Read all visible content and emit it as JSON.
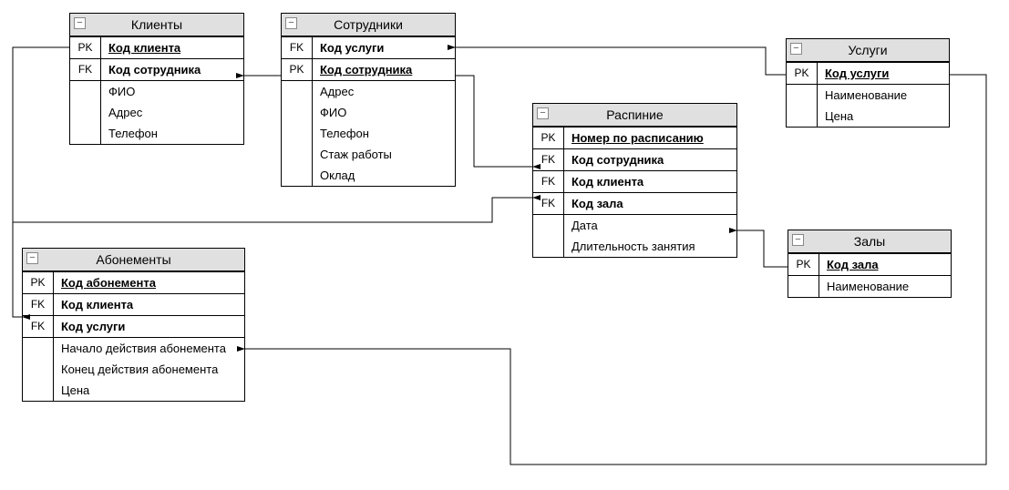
{
  "entities": {
    "clients": {
      "title": "Клиенты",
      "rows": [
        {
          "key": "PK",
          "label": "Код клиента",
          "cls": "pk"
        },
        {
          "key": "FK",
          "label": "Код сотрудника",
          "cls": "fk"
        },
        {
          "key": "",
          "label": "ФИО"
        },
        {
          "key": "",
          "label": "Адрес"
        },
        {
          "key": "",
          "label": "Телефон"
        }
      ]
    },
    "employees": {
      "title": "Сотрудники",
      "rows": [
        {
          "key": "FK",
          "label": "Код услуги",
          "cls": "fk"
        },
        {
          "key": "PK",
          "label": "Код сотрудника",
          "cls": "pk"
        },
        {
          "key": "",
          "label": "Адрес"
        },
        {
          "key": "",
          "label": "ФИО"
        },
        {
          "key": "",
          "label": "Телефон"
        },
        {
          "key": "",
          "label": "Стаж работы"
        },
        {
          "key": "",
          "label": "Оклад"
        }
      ]
    },
    "schedule": {
      "title": "Распиние",
      "rows": [
        {
          "key": "PK",
          "label": "Номер по расписанию",
          "cls": "pk"
        },
        {
          "key": "FK",
          "label": "Код сотрудника",
          "cls": "fk"
        },
        {
          "key": "FK",
          "label": "Код клиента",
          "cls": "fk"
        },
        {
          "key": "FK",
          "label": "Код зала",
          "cls": "fk"
        },
        {
          "key": "",
          "label": "Дата"
        },
        {
          "key": "",
          "label": "Длительность занятия"
        }
      ]
    },
    "services": {
      "title": "Услуги",
      "rows": [
        {
          "key": "PK",
          "label": "Код услуги",
          "cls": "pk"
        },
        {
          "key": "",
          "label": "Наименование"
        },
        {
          "key": "",
          "label": "Цена"
        }
      ]
    },
    "subscriptions": {
      "title": "Абонементы",
      "rows": [
        {
          "key": "PK",
          "label": "Код абонемента",
          "cls": "pk"
        },
        {
          "key": "FK",
          "label": "Код клиента",
          "cls": "fk"
        },
        {
          "key": "FK",
          "label": "Код услуги",
          "cls": "fk"
        },
        {
          "key": "",
          "label": "Начало действия абонемента"
        },
        {
          "key": "",
          "label": "Конец действия абонемента"
        },
        {
          "key": "",
          "label": "Цена"
        }
      ]
    },
    "halls": {
      "title": "Залы",
      "rows": [
        {
          "key": "PK",
          "label": "Код зала",
          "cls": "pk"
        },
        {
          "key": "",
          "label": "Наименование"
        }
      ]
    }
  },
  "relationships": [
    {
      "from": "clients.Код сотрудника",
      "to": "employees.Код сотрудника"
    },
    {
      "from": "employees.Код услуги",
      "to": "services.Код услуги"
    },
    {
      "from": "schedule.Код сотрудника",
      "to": "employees.Код сотрудника"
    },
    {
      "from": "schedule.Код клиента",
      "to": "clients.Код клиента"
    },
    {
      "from": "schedule.Код зала",
      "to": "halls.Код зала"
    },
    {
      "from": "subscriptions.Код клиента",
      "to": "clients.Код клиента"
    },
    {
      "from": "subscriptions.Код услуги",
      "to": "services.Код услуги"
    }
  ]
}
